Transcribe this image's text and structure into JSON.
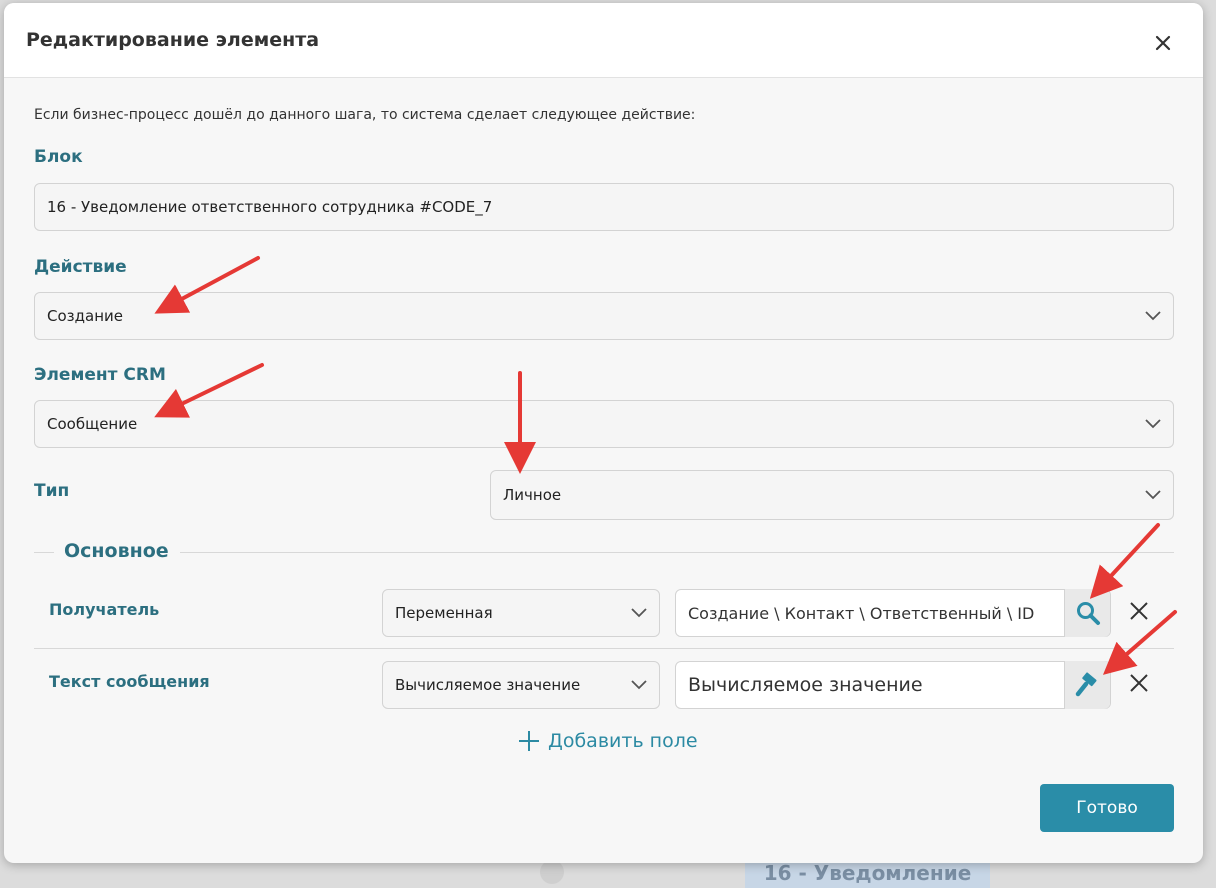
{
  "background": {
    "partial_block_text": "16 - Уведомление"
  },
  "dialog": {
    "title": "Редактирование элемента",
    "intro": "Если бизнес-процесс дошёл до данного шага, то система сделает следующее действие:",
    "block": {
      "label": "Блок",
      "value": "16 - Уведомление ответственного сотрудника #CODE_7"
    },
    "action": {
      "label": "Действие",
      "value": "Создание"
    },
    "crm_element": {
      "label": "Элемент CRM",
      "value": "Сообщение"
    },
    "type": {
      "label": "Тип",
      "value": "Личное"
    },
    "section": {
      "title": "Основное"
    },
    "rows": [
      {
        "label": "Получатель",
        "mode": "Переменная",
        "value": "Создание \\ Контакт \\ Ответственный \\ ID",
        "button_icon": "search-icon"
      },
      {
        "label": "Текст сообщения",
        "mode": "Вычисляемое значение",
        "value": "Вычисляемое значение",
        "button_icon": "hammer-icon"
      }
    ],
    "add_field_label": "Добавить поле",
    "done_label": "Готово"
  },
  "colors": {
    "accent": "#2c6f80",
    "button": "#2a8da8",
    "annotation_arrow": "#e53935"
  }
}
